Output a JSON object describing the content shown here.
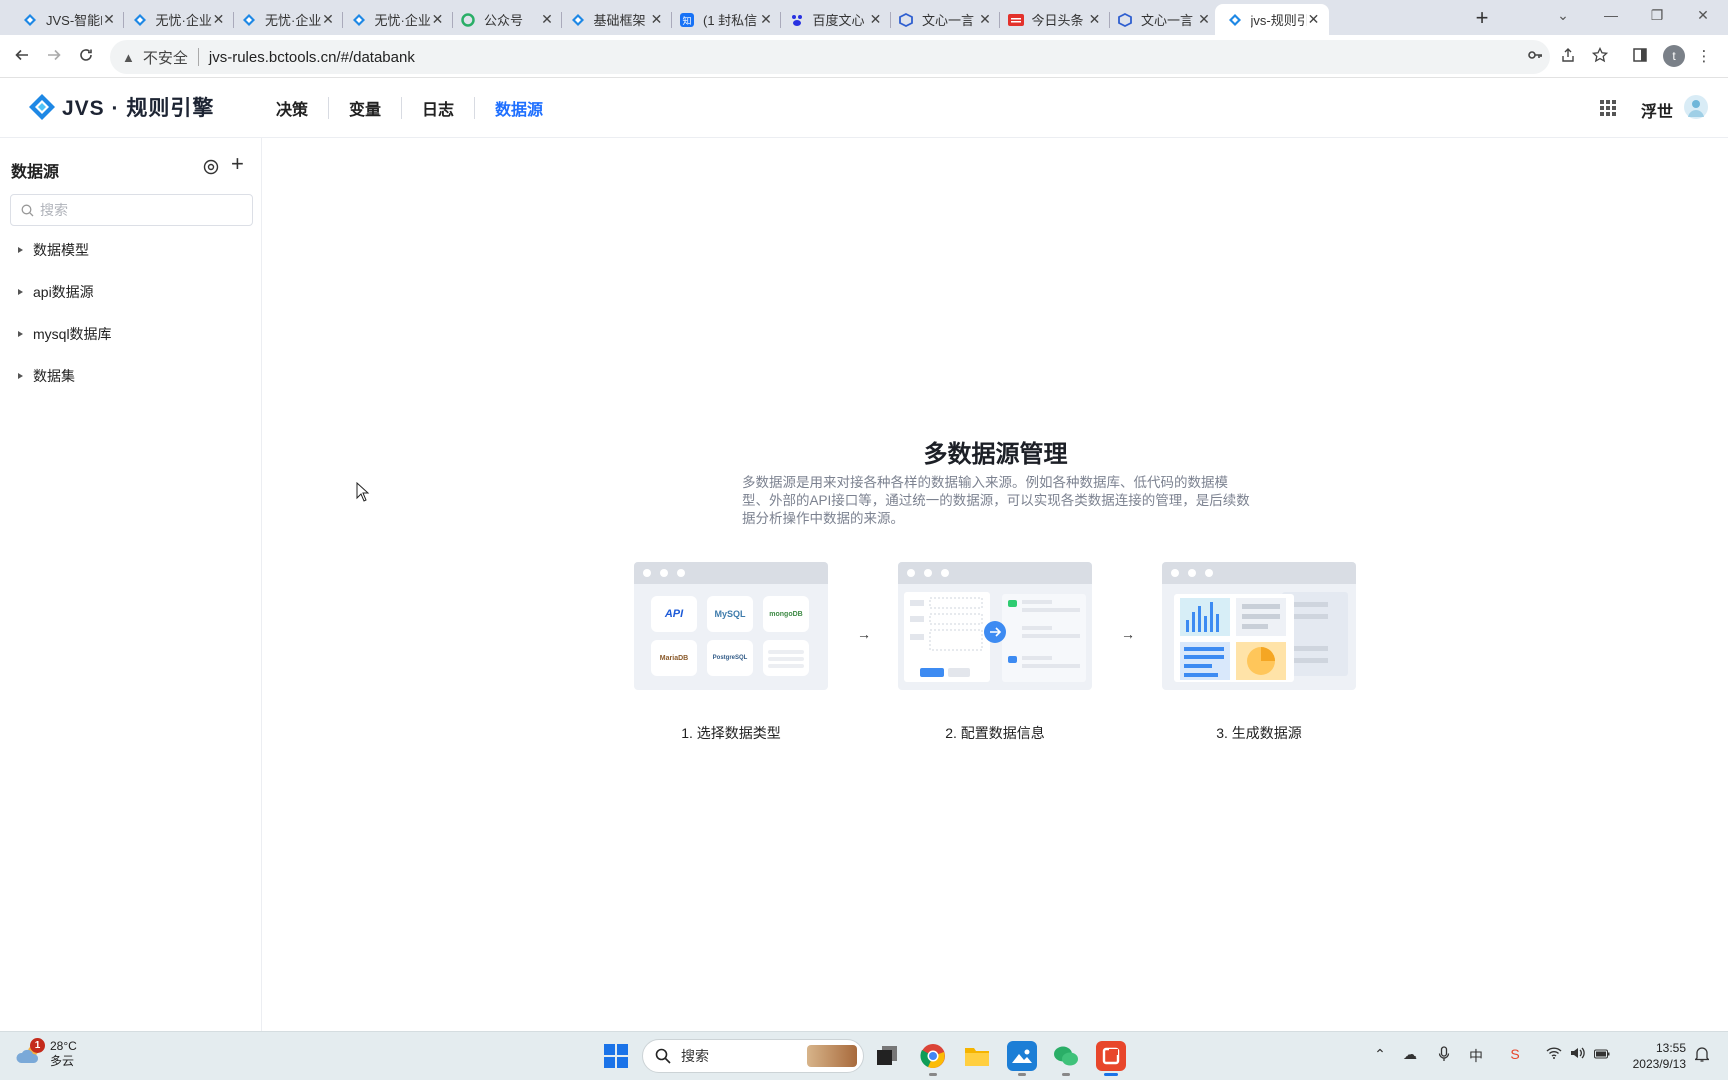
{
  "browser": {
    "tabs": [
      {
        "label": "JVS-智能B",
        "icon": "jvs",
        "color": "#1e88e5"
      },
      {
        "label": "无忧·企业",
        "icon": "jvs",
        "color": "#1e88e5"
      },
      {
        "label": "无忧·企业",
        "icon": "jvs",
        "color": "#1e88e5"
      },
      {
        "label": "无忧·企业",
        "icon": "jvs",
        "color": "#1e88e5"
      },
      {
        "label": "公众号",
        "icon": "wechat",
        "color": "#2aae67"
      },
      {
        "label": "基础框架",
        "icon": "jvs",
        "color": "#1e88e5"
      },
      {
        "label": "(1 封私信",
        "icon": "zhihu",
        "color": "#1772f6"
      },
      {
        "label": "百度文心",
        "icon": "baidu",
        "color": "#2932e1"
      },
      {
        "label": "文心一言",
        "icon": "cube",
        "color": "#2f5fd0"
      },
      {
        "label": "今日头条",
        "icon": "toutiao",
        "color": "#e3312b"
      },
      {
        "label": "文心一言",
        "icon": "cube",
        "color": "#2f5fd0"
      },
      {
        "label": "jvs-规则引",
        "icon": "jvs",
        "color": "#1e88e5"
      }
    ],
    "close_glyph": "✕",
    "new_tab_glyph": "+",
    "window_controls": [
      "⌄",
      "—",
      "❐",
      "✕"
    ],
    "address": {
      "insecure_label": "不安全",
      "url": "jvs-rules.bctools.cn/#/databank"
    },
    "profile_initial": "t"
  },
  "app": {
    "logo_text": "JVS · 规则引擎",
    "nav": [
      {
        "label": "决策",
        "active": false
      },
      {
        "label": "变量",
        "active": false
      },
      {
        "label": "日志",
        "active": false
      },
      {
        "label": "数据源",
        "active": true
      }
    ],
    "user_name": "浮世",
    "accent": "#1e6fff"
  },
  "sidebar": {
    "title": "数据源",
    "search_placeholder": "搜索",
    "tree": [
      {
        "label": "数据模型"
      },
      {
        "label": "api数据源"
      },
      {
        "label": "mysql数据库"
      },
      {
        "label": "数据集"
      }
    ]
  },
  "main": {
    "title": "多数据源管理",
    "description": "多数据源是用来对接各种各样的数据输入来源。例如各种数据库、低代码的数据模型、外部的API接口等，通过统一的数据源，可以实现各类数据连接的管理，是后续数据分析操作中数据的来源。",
    "steps": [
      {
        "label": "1. 选择数据类型",
        "chips": [
          "API",
          "MySQL",
          "mongoDB",
          "MariaDB",
          "PostgreSQL",
          ""
        ]
      },
      {
        "label": "2. 配置数据信息"
      },
      {
        "label": "3. 生成数据源"
      }
    ],
    "arrow_glyph": "→"
  },
  "taskbar": {
    "weather_temp": "28°C",
    "weather_desc": "多云",
    "weather_badge": "1",
    "search_label": "搜索",
    "ime_label": "中",
    "time": "13:55",
    "date": "2023/9/13"
  }
}
